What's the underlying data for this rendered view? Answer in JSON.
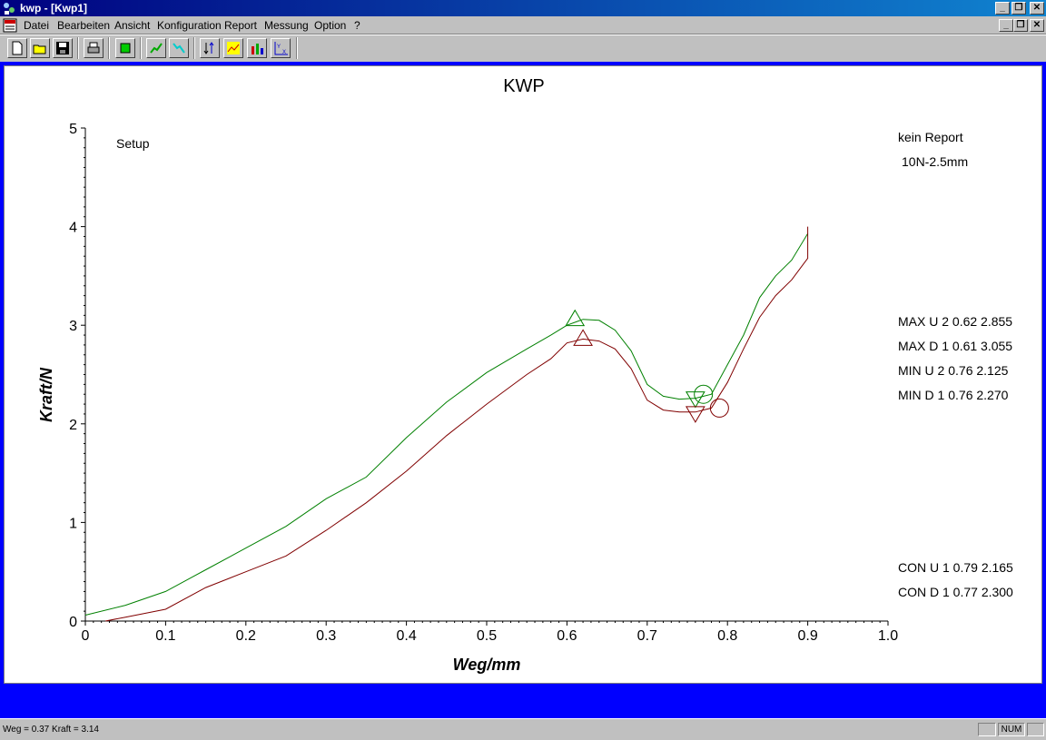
{
  "window": {
    "title": "kwp - [Kwp1]"
  },
  "menu": {
    "items": [
      {
        "label": "Datei"
      },
      {
        "label": "Bearbeiten"
      },
      {
        "label": "Ansicht"
      },
      {
        "label": "Konfiguration"
      },
      {
        "label": "Report"
      },
      {
        "label": "Messung"
      },
      {
        "label": "Option"
      },
      {
        "label": "?"
      }
    ]
  },
  "toolbar": {
    "buttons": [
      "new-file-icon",
      "open-folder-icon",
      "save-disk-icon",
      "print-icon",
      "stop-green-icon",
      "measure-up-icon",
      "measure-down-icon",
      "sort-icon",
      "chart-icon",
      "bars-icon",
      "xy-scale-icon"
    ]
  },
  "chart_data": {
    "type": "line",
    "title": "KWP",
    "xlabel": "Weg/mm",
    "ylabel": "Kraft/N",
    "xlim": [
      0,
      1.0
    ],
    "ylim": [
      0,
      5
    ],
    "x_ticks": [
      "0",
      "0.1",
      "0.2",
      "0.3",
      "0.4",
      "0.5",
      "0.6",
      "0.7",
      "0.8",
      "0.9",
      "1.0"
    ],
    "y_ticks": [
      "0",
      "1",
      "2",
      "3",
      "4",
      "5"
    ],
    "grid": false,
    "series": [
      {
        "color": "#008000",
        "x": [
          0,
          0.05,
          0.1,
          0.15,
          0.2,
          0.25,
          0.3,
          0.35,
          0.4,
          0.45,
          0.5,
          0.55,
          0.58,
          0.6,
          0.62,
          0.64,
          0.66,
          0.68,
          0.7,
          0.72,
          0.74,
          0.76,
          0.78,
          0.8,
          0.82,
          0.84,
          0.86,
          0.88,
          0.9
        ],
        "y": [
          0.06,
          0.16,
          0.3,
          0.52,
          0.74,
          0.96,
          1.24,
          1.46,
          1.86,
          2.22,
          2.52,
          2.76,
          2.9,
          3.0,
          3.06,
          3.05,
          2.95,
          2.74,
          2.4,
          2.28,
          2.25,
          2.26,
          2.3,
          2.6,
          2.9,
          3.28,
          3.5,
          3.66,
          3.93
        ]
      },
      {
        "color": "#800000",
        "x": [
          0.025,
          0.05,
          0.1,
          0.15,
          0.2,
          0.25,
          0.3,
          0.35,
          0.4,
          0.45,
          0.5,
          0.55,
          0.58,
          0.6,
          0.62,
          0.64,
          0.66,
          0.68,
          0.7,
          0.72,
          0.74,
          0.76,
          0.78,
          0.8,
          0.82,
          0.84,
          0.86,
          0.88,
          0.9,
          0.9
        ],
        "y": [
          0,
          0.04,
          0.12,
          0.34,
          0.5,
          0.66,
          0.92,
          1.2,
          1.52,
          1.88,
          2.2,
          2.5,
          2.66,
          2.82,
          2.86,
          2.84,
          2.76,
          2.56,
          2.24,
          2.14,
          2.12,
          2.12,
          2.16,
          2.42,
          2.76,
          3.08,
          3.3,
          3.46,
          3.68,
          4.0
        ]
      }
    ],
    "markers": [
      {
        "shape": "triangle-up",
        "x": 0.61,
        "y": 3.06,
        "color": "#008000"
      },
      {
        "shape": "triangle-up",
        "x": 0.62,
        "y": 2.86,
        "color": "#800000"
      },
      {
        "shape": "triangle-down",
        "x": 0.76,
        "y": 2.26,
        "color": "#008000"
      },
      {
        "shape": "triangle-down",
        "x": 0.76,
        "y": 2.11,
        "color": "#800000"
      },
      {
        "shape": "circle",
        "x": 0.77,
        "y": 2.3,
        "color": "#008000"
      },
      {
        "shape": "circle",
        "x": 0.79,
        "y": 2.16,
        "color": "#800000"
      }
    ],
    "annotations": {
      "setup": "Setup",
      "report": "kein Report",
      "spec": "10N-2.5mm",
      "max_u": "MAX U 2  0.62 2.855",
      "max_d": "MAX D 1  0.61 3.055",
      "min_u": "MIN U 2  0.76 2.125",
      "min_d": "MIN D 1  0.76 2.270",
      "con_u": "CON U 1  0.79 2.165",
      "con_d": "CON D 1  0.77 2.300"
    }
  },
  "status": {
    "text": "Weg =   0.37 Kraft =   3.14",
    "num": "NUM"
  }
}
